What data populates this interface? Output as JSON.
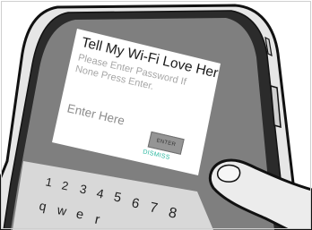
{
  "dialog": {
    "title": "Tell My Wi-Fi Love Her",
    "message": "Please Enter Password If None Press Enter.",
    "input_placeholder": "Enter Here",
    "enter_button": "ENTER",
    "dismiss_link": "DISMISS"
  },
  "keyboard": {
    "number_row": [
      "1",
      "2",
      "3",
      "4",
      "5",
      "6",
      "7",
      "8"
    ],
    "letter_row": [
      "q",
      "w",
      "e",
      "r"
    ]
  },
  "colors": {
    "screen_background": "#7f7f7f",
    "dialog_background": "#ffffff",
    "keyboard_background": "#d8d8d8",
    "dismiss_accent": "#2bb8a0",
    "enter_button": "#959595"
  }
}
